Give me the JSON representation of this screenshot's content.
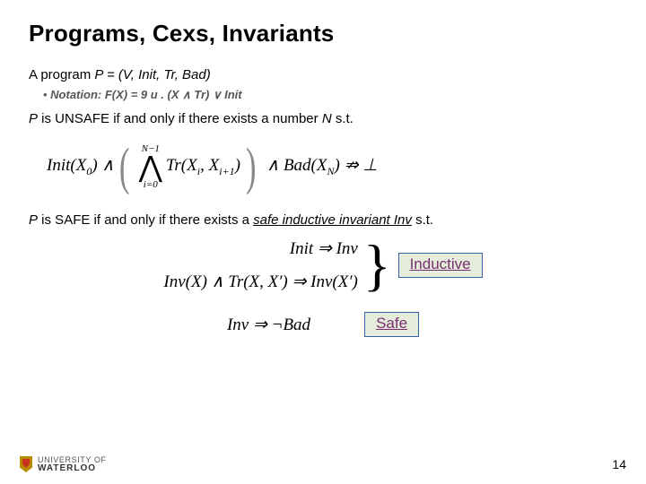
{
  "title": "Programs, Cexs, Invariants",
  "def_line_pre": "A program ",
  "def_line_expr": "P = (V, Init, Tr, Bad)",
  "notation": "Notation: F(X) = 9 u . (X ∧ Tr) ∨ Init",
  "unsafe_pre": "P",
  "unsafe_mid": " is UNSAFE if and only if there exists a number ",
  "unsafe_N": "N",
  "unsafe_post": " s.t.",
  "formula_unsafe": {
    "init": "Init(X",
    "init_sub": "0",
    "init_close": ") ∧",
    "big_top": "N−1",
    "big_bot": "i=0",
    "tr": "Tr(X",
    "tr_i": "i",
    "tr_mid": ", X",
    "tr_i1": "i+1",
    "tr_close": ")",
    "and_bad": "∧ Bad(X",
    "bad_N": "N",
    "bad_close": ")   ⇏   ⊥"
  },
  "safe_pre": "P",
  "safe_mid": " is SAFE if and only if there exists a ",
  "safe_em": "safe inductive invariant",
  "safe_inv": " Inv",
  "safe_post": " s.t.",
  "ind_line1": "Init ⇒ Inv",
  "ind_line2": "Inv(X) ∧ Tr(X, X′) ⇒ Inv(X′)",
  "tag_inductive": "Inductive",
  "safe_formula": "Inv ⇒ ¬Bad",
  "tag_safe": "Safe",
  "logo_top": "UNIVERSITY OF",
  "logo_bottom": "WATERLOO",
  "page": "14"
}
